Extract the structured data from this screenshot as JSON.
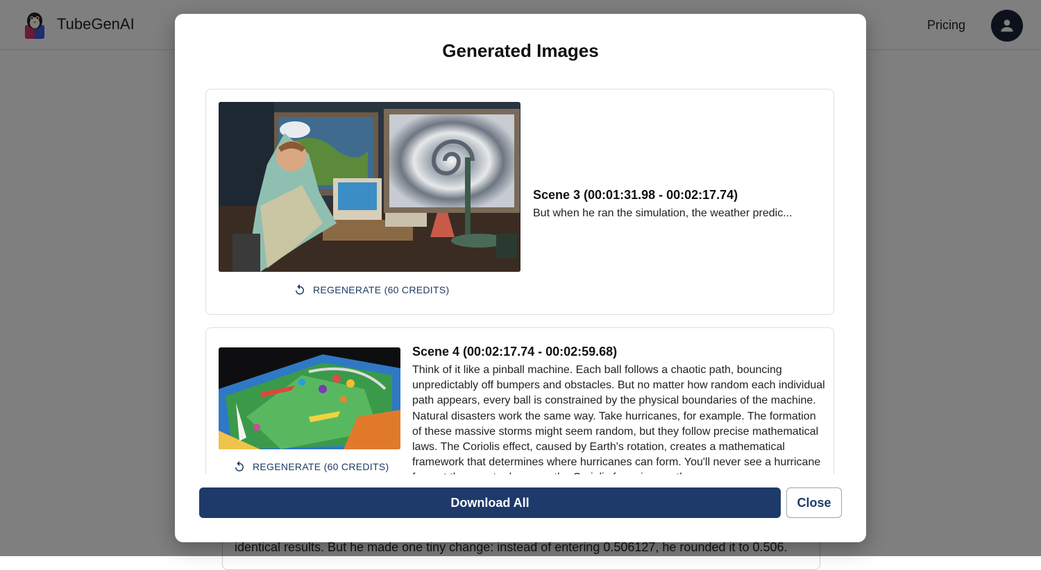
{
  "app": {
    "brand": "TubeGenAI",
    "nav_pricing": "Pricing",
    "background_text": "identical results. But he made one tiny change: instead of entering 0.506127, he rounded it to 0.506."
  },
  "modal": {
    "title": "Generated Images",
    "scenes": [
      {
        "title": "Scene 3 (00:01:31.98 - 00:02:17.74)",
        "text": "But when he ran the simulation, the weather predic...",
        "regenerate_label": "REGENERATE (60 CREDITS)"
      },
      {
        "title": "Scene 4 (00:02:17.74 - 00:02:59.68)",
        "text": "Think of it like a pinball machine. Each ball follows a chaotic path, bouncing unpredictably off bumpers and obstacles. But no matter how random each individual path appears, every ball is constrained by the physical boundaries of the machine. Natural disasters work the same way. Take hurricanes, for example. The formation of these massive storms might seem random, but they follow precise mathematical laws. The Coriolis effect, caused by Earth's rotation, creates a mathematical framework that determines where hurricanes can form. You'll never see a hurricane form at the equator because the Coriolis force is zero there.",
        "regenerate_label": "REGENERATE (60 CREDITS)"
      }
    ],
    "download_all_label": "Download All",
    "close_label": "Close"
  },
  "colors": {
    "primary": "#1d3a6b",
    "overlay": "rgba(0,0,0,0.5)"
  },
  "icons": {
    "regenerate": "refresh-icon",
    "avatar": "user-icon",
    "logo": "penguin-logo-icon"
  }
}
